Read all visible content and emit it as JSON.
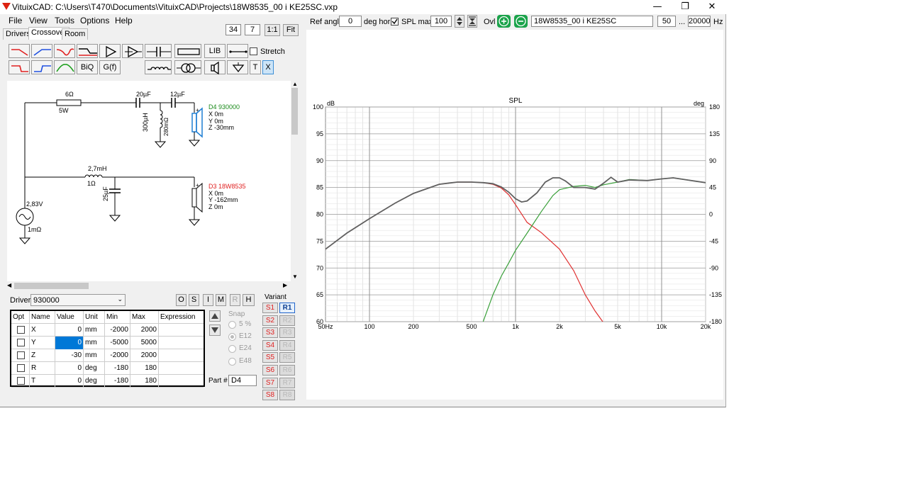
{
  "window": {
    "title": "VituixCAD: C:\\Users\\T470\\Documents\\VituixCAD\\Projects\\18W8535_00 i KE25SC.vxp",
    "controls": {
      "minimize": "—",
      "restore": "❐",
      "close": "✕"
    }
  },
  "menu": [
    "File",
    "View",
    "Tools",
    "Options",
    "Help"
  ],
  "tabs": [
    "Drivers",
    "Crossover",
    "Room"
  ],
  "active_tab": "Crossover",
  "zoom": {
    "value": "34",
    "step": "7",
    "one_to_one": "1:1",
    "fit": "Fit"
  },
  "toolbar": {
    "lib": "LIB",
    "biq": "BiQ",
    "gf": "G(f)",
    "t": "T",
    "x": "X",
    "stretch_label": "Stretch",
    "stretch_checked": false
  },
  "schematic": {
    "r1": "6Ω",
    "r1_power": "5W",
    "c1": "20µF",
    "c2": "12µF",
    "l1": "300µH",
    "l1_r": "280mΩ",
    "l2": "2,7mH",
    "l2_r": "1Ω",
    "c3": "25µF",
    "source_v": "2,83V",
    "source_r": "1mΩ",
    "d4": {
      "name": "D4 930000",
      "x": "X 0m",
      "y": "Y 0m",
      "z": "Z -30mm"
    },
    "d3": {
      "name": "D3 18W8535",
      "x": "X 0m",
      "y": "Y -162mm",
      "z": "Z 0m"
    }
  },
  "driver": {
    "label": "Driver",
    "selected": "930000",
    "mode_buttons": [
      "O",
      "S",
      "I",
      "M",
      "R",
      "H"
    ]
  },
  "param_table": {
    "headers": [
      "Opt",
      "Name",
      "Value",
      "Unit",
      "Min",
      "Max",
      "Expression"
    ],
    "rows": [
      {
        "name": "X",
        "value": "0",
        "unit": "mm",
        "min": "-2000",
        "max": "2000",
        "expr": ""
      },
      {
        "name": "Y",
        "value": "0",
        "unit": "mm",
        "min": "-5000",
        "max": "5000",
        "expr": ""
      },
      {
        "name": "Z",
        "value": "-30",
        "unit": "mm",
        "min": "-2000",
        "max": "2000",
        "expr": ""
      },
      {
        "name": "R",
        "value": "0",
        "unit": "deg",
        "min": "-180",
        "max": "180",
        "expr": ""
      },
      {
        "name": "T",
        "value": "0",
        "unit": "deg",
        "min": "-180",
        "max": "180",
        "expr": ""
      }
    ]
  },
  "snap": {
    "label": "Snap",
    "options": [
      "5 %",
      "E12",
      "E24",
      "E48"
    ],
    "selected": "E12"
  },
  "part": {
    "label": "Part #",
    "value": "D4"
  },
  "variant": {
    "label": "Variant",
    "s": [
      "S1",
      "S2",
      "S3",
      "S4",
      "S5",
      "S6",
      "S7",
      "S8"
    ],
    "r": [
      "R1",
      "R2",
      "R3",
      "R4",
      "R5",
      "R6",
      "R7",
      "R8"
    ],
    "active_r": "R1"
  },
  "plot_toolbar": {
    "ref_angle_label": "Ref angle",
    "ref_angle": "0",
    "deg_hor": "deg hor",
    "spl_max_label": "SPL max",
    "spl_max_checked": true,
    "spl_max": "100",
    "ovl": "Ovl",
    "overlay_name": "18W8535_00 i KE25SC",
    "f_min": "50",
    "dots": "...",
    "f_max": "20000",
    "hz": "Hz"
  },
  "chart_data": {
    "type": "line",
    "title": "SPL",
    "ylabel": "dB",
    "y2label": "deg",
    "xscale": "log",
    "xlim": [
      50,
      20000
    ],
    "ylim": [
      60,
      100
    ],
    "y2lim": [
      -180,
      180
    ],
    "xticks": [
      50,
      100,
      200,
      500,
      1000,
      2000,
      5000,
      10000,
      20000
    ],
    "xticklabels": [
      "50Hz",
      "100",
      "200",
      "500",
      "1k",
      "2k",
      "5k",
      "10k",
      "20k"
    ],
    "yticks": [
      60,
      65,
      70,
      75,
      80,
      85,
      90,
      95,
      100
    ],
    "y2ticks": [
      -180,
      -135,
      -90,
      -45,
      0,
      45,
      90,
      135,
      180
    ],
    "grid": true,
    "series": [
      {
        "color": "#e03030",
        "x": [
          50,
          70,
          100,
          150,
          200,
          300,
          400,
          500,
          600,
          700,
          800,
          900,
          1000,
          1200,
          1500,
          2000,
          2500,
          3000,
          3500,
          4000
        ],
        "y": [
          73.5,
          76.5,
          79.2,
          82.1,
          83.9,
          85.6,
          86.0,
          86.0,
          85.9,
          85.6,
          84.9,
          83.6,
          81.8,
          78.5,
          76.6,
          73.5,
          69.5,
          65.0,
          62.0,
          59.8
        ]
      },
      {
        "color": "#3aa03a",
        "x": [
          600,
          700,
          800,
          900,
          1000,
          1200,
          1500,
          1800,
          2000,
          2500,
          3000,
          3500,
          4000,
          5000,
          6000,
          8000,
          10000,
          12000,
          15000,
          20000
        ],
        "y": [
          60,
          65,
          68.5,
          71,
          73.3,
          76.5,
          80.5,
          83.5,
          84.6,
          85.2,
          85.4,
          85.0,
          85.5,
          86.0,
          86.5,
          86.3,
          86.6,
          86.8,
          86.4,
          85.9
        ]
      },
      {
        "color": "#606060",
        "x": [
          50,
          70,
          100,
          150,
          200,
          300,
          400,
          500,
          600,
          700,
          800,
          900,
          1000,
          1100,
          1200,
          1400,
          1600,
          1800,
          2000,
          2200,
          2500,
          3000,
          3500,
          4000,
          4500,
          5000,
          6000,
          8000,
          10000,
          12000,
          15000,
          20000
        ],
        "y": [
          73.5,
          76.5,
          79.2,
          82.1,
          83.9,
          85.6,
          86.0,
          86.0,
          85.9,
          85.7,
          85.1,
          84.1,
          82.9,
          82.3,
          82.5,
          84.0,
          86.0,
          86.8,
          86.8,
          86.2,
          85.0,
          85.0,
          84.7,
          85.8,
          86.9,
          86.0,
          86.4,
          86.3,
          86.6,
          86.8,
          86.4,
          85.9
        ]
      }
    ]
  }
}
